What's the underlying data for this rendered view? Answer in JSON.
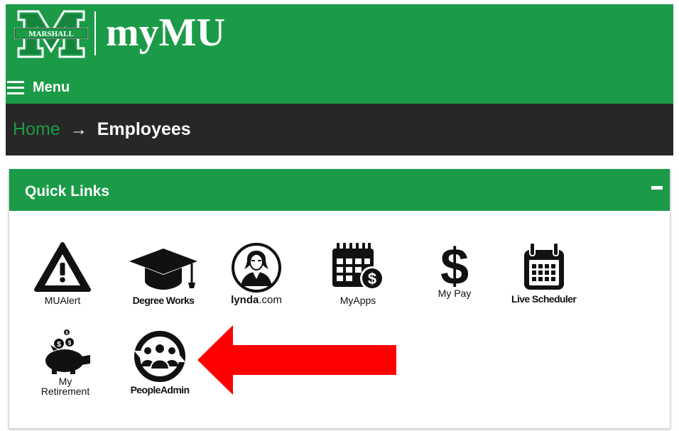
{
  "header": {
    "logo_text": "MARSHALL",
    "brand": "myMU",
    "menu_label": "Menu",
    "bg_color": "#1b9b48"
  },
  "breadcrumb": {
    "home": "Home",
    "separator": "→",
    "current": "Employees"
  },
  "quick_links": {
    "title": "Quick Links",
    "collapse_label": "−",
    "items": [
      {
        "label": "MUAlert",
        "icon": "warning-triangle-icon"
      },
      {
        "label": "Degree Works",
        "icon": "graduation-cap-icon"
      },
      {
        "label": "lynda",
        "label_suffix": ".com",
        "icon": "lynda-portrait-icon"
      },
      {
        "label": "MyApps",
        "icon": "calendar-grid-dollar-icon"
      },
      {
        "label": "My Pay",
        "icon": "dollar-sign-icon"
      },
      {
        "label": "Live Scheduler",
        "icon": "calendar-icon"
      },
      {
        "label": "My",
        "label2": "Retirement",
        "icon": "piggy-bank-icon"
      },
      {
        "label": "PeopleAdmin",
        "icon": "people-circle-icon"
      }
    ]
  },
  "annotation": {
    "arrow_color": "#ff0000",
    "arrow_points_to": "PeopleAdmin"
  }
}
